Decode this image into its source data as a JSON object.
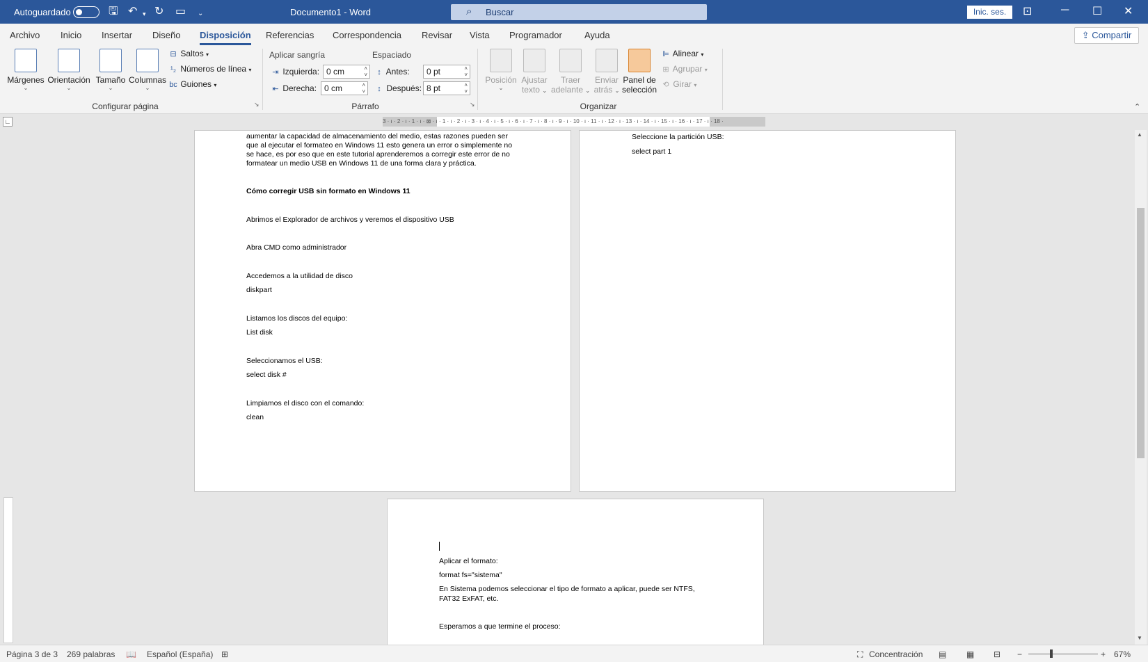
{
  "titlebar": {
    "autosave_label": "Autoguardado",
    "doc_title": "Documento1  -  Word",
    "search_placeholder": "Buscar",
    "signin": "Inic. ses."
  },
  "tabs": [
    "Archivo",
    "Inicio",
    "Insertar",
    "Diseño",
    "Disposición",
    "Referencias",
    "Correspondencia",
    "Revisar",
    "Vista",
    "Programador",
    "Ayuda"
  ],
  "active_tab": "Disposición",
  "share_label": "Compartir",
  "ribbon": {
    "page_setup": {
      "margins": "Márgenes",
      "orientation": "Orientación",
      "size": "Tamaño",
      "columns": "Columnas",
      "breaks": "Saltos",
      "line_numbers": "Números de línea",
      "hyphenation": "Guiones",
      "group_label": "Configurar página"
    },
    "paragraph": {
      "indent_title": "Aplicar sangría",
      "spacing_title": "Espaciado",
      "left_label": "Izquierda:",
      "left_value": "0 cm",
      "right_label": "Derecha:",
      "right_value": "0 cm",
      "before_label": "Antes:",
      "before_value": "0 pt",
      "after_label": "Después:",
      "after_value": "8 pt",
      "group_label": "Párrafo"
    },
    "arrange": {
      "position": "Posición",
      "wrap_1": "Ajustar",
      "wrap_2": "texto",
      "forward_1": "Traer",
      "forward_2": "adelante",
      "backward_1": "Enviar",
      "backward_2": "atrás",
      "panel_1": "Panel de",
      "panel_2": "selección",
      "align": "Alinear",
      "group": "Agrupar",
      "rotate": "Girar",
      "group_label": "Organizar"
    }
  },
  "ruler_text": "3 · ı · 2 · ı · 1 · ı · ⊠ · ı · 1 · ı · 2 · ı · 3 · ı · 4 · ı · 5 · ı · 6 · ı · 7 · ı · 8 · ı · 9 · ı · 10 · ı · 11 · ı · 12 · ı · 13 · ı · 14 · ı · 15 · ı · 16 · ı · 17 · ı · 18 ·",
  "page_left": {
    "lines": [
      "aumentar la capacidad de almacenamiento del medio, estas razones pueden ser",
      "que al ejecutar el formateo en Windows 11 esto genera un error o simplemente no",
      "se hace, es por eso que en este tutorial aprenderemos a corregir este error de no",
      "formatear un medio USB en Windows 11 de una forma clara y práctica."
    ],
    "heading": "Cómo corregir USB sin formato en Windows 11",
    "items": [
      "Abrimos el Explorador de archivos y veremos el dispositivo USB",
      "Abra CMD como administrador",
      "Accedemos a la utilidad de disco",
      "diskpart",
      "Listamos los discos del equipo:",
      "List disk",
      "Seleccionamos el USB:",
      "select disk #",
      "Limpiamos el disco con el comando:",
      "clean"
    ]
  },
  "page_right": {
    "items": [
      "Seleccione la partición USB:",
      "select part 1"
    ]
  },
  "page_bottom": {
    "items": [
      "Aplicar el formato:",
      "format fs=\"sistema\"",
      "En Sistema podemos seleccionar el tipo de formato a aplicar, puede ser NTFS,",
      "FAT32 ExFAT, etc.",
      "Esperamos a que termine el proceso:"
    ]
  },
  "statusbar": {
    "page": "Página 3 de 3",
    "words": "269 palabras",
    "language": "Español (España)",
    "focus": "Concentración",
    "zoom": "67%"
  }
}
